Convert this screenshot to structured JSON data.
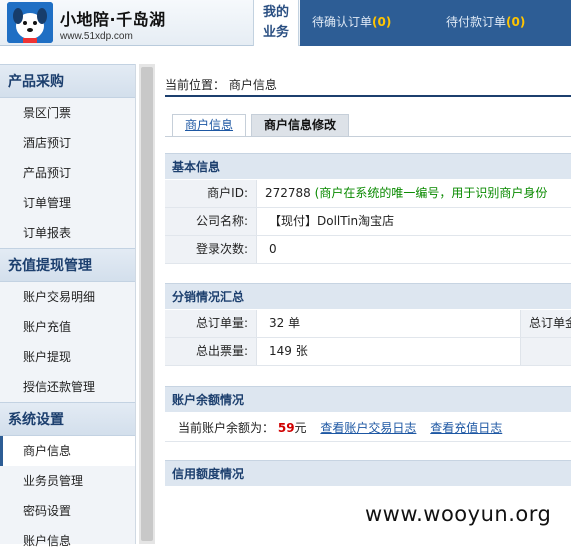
{
  "header": {
    "logo_title": "小地陪·千岛湖",
    "logo_url": "www.51xdp.com",
    "my_business_line1": "我的",
    "my_business_line2": "业务",
    "nav": [
      {
        "label": "待确认订单",
        "count": "0"
      },
      {
        "label": "待付款订单",
        "count": "0"
      }
    ]
  },
  "sidebar": {
    "sections": [
      {
        "title": "产品采购",
        "items": [
          "景区门票",
          "酒店预订",
          "产品预订",
          "订单管理",
          "订单报表"
        ]
      },
      {
        "title": "充值提现管理",
        "items": [
          "账户交易明细",
          "账户充值",
          "账户提现",
          "授信还款管理"
        ]
      },
      {
        "title": "系统设置",
        "items": [
          "商户信息",
          "业务员管理",
          "密码设置",
          "账户信息"
        ]
      }
    ]
  },
  "main": {
    "breadcrumb": "当前位置： 商户信息",
    "tabs": [
      "商户信息",
      "商户信息修改"
    ],
    "basic": {
      "title": "基本信息",
      "merchant_id_label": "商户ID:",
      "merchant_id_value": "272788",
      "merchant_id_note": "(商户在系统的唯一编号，用于识别商户身份",
      "company_label": "公司名称:",
      "company_value": "【现付】DollTin淘宝店",
      "login_label": "登录次数:",
      "login_value": "0"
    },
    "distribution": {
      "title": "分销情况汇总",
      "total_orders_label": "总订单量:",
      "total_orders_value": "32 单",
      "total_orders_col3": "总订单金",
      "total_tickets_label": "总出票量:",
      "total_tickets_value": "149 张"
    },
    "balance": {
      "title": "账户余额情况",
      "label": "当前账户余额为：",
      "amount": "59",
      "unit": "元",
      "link1": "查看账户交易日志",
      "link2": "查看充值日志"
    },
    "credit": {
      "title": "信用额度情况"
    }
  },
  "watermark": "www.wooyun.org"
}
